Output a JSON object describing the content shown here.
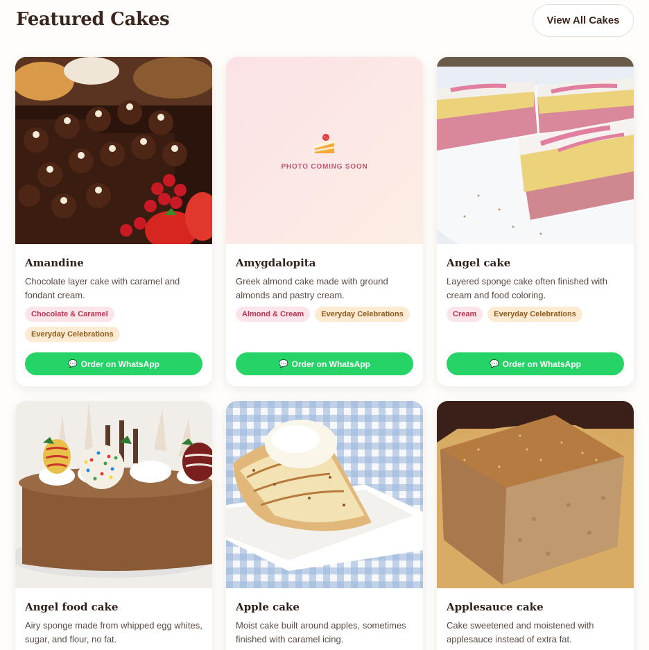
{
  "header": {
    "title": "Featured Cakes",
    "view_all_label": "View All Cakes"
  },
  "order_label": "Order on WhatsApp",
  "photo_placeholder": "PHOTO COMING SOON",
  "colors": {
    "whatsapp": "#25d366",
    "tag_pink_bg": "#fbe4ea",
    "tag_peach_bg": "#fcebd2"
  },
  "cakes": [
    {
      "name": "Amandine",
      "description": "Chocolate layer cake with caramel and fondant cream.",
      "tags": [
        "Chocolate & Caramel",
        "Everyday Celebrations"
      ],
      "has_photo": true
    },
    {
      "name": "Amygdalopita",
      "description": "Greek almond cake made with ground almonds and pastry cream.",
      "tags": [
        "Almond & Cream",
        "Everyday Celebrations"
      ],
      "has_photo": false
    },
    {
      "name": "Angel cake",
      "description": "Layered sponge cake often finished with cream and food coloring.",
      "tags": [
        "Cream",
        "Everyday Celebrations"
      ],
      "has_photo": true
    },
    {
      "name": "Angel food cake",
      "description": "Airy sponge made from whipped egg whites, sugar, and flour, no fat.",
      "tags": [],
      "has_photo": true
    },
    {
      "name": "Apple cake",
      "description": "Moist cake built around apples, sometimes finished with caramel icing.",
      "tags": [],
      "has_photo": true
    },
    {
      "name": "Applesauce cake",
      "description": "Cake sweetened and moistened with applesauce instead of extra fat.",
      "tags": [],
      "has_photo": true
    }
  ]
}
